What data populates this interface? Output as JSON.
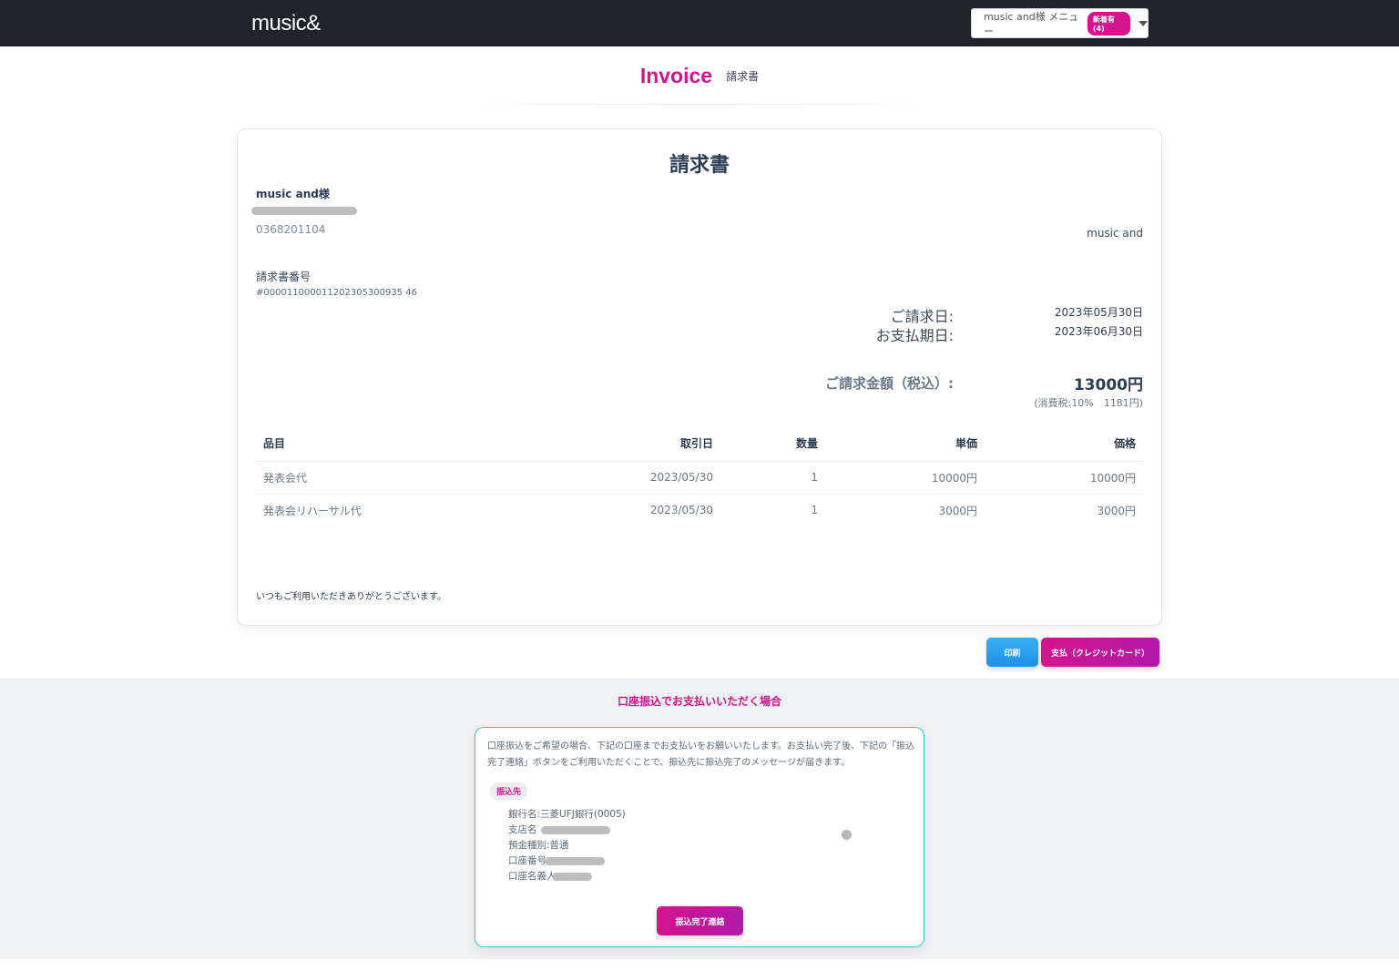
{
  "header": {
    "brand": "music&",
    "menu_label": "music and様 メニュー",
    "menu_badge": "新着有(4)"
  },
  "page": {
    "title_en": "Invoice",
    "title_jp": "請求書"
  },
  "invoice": {
    "doc_title": "請求書",
    "customer_name": "music and様",
    "customer_phone": "0368201104",
    "issuer": "music and",
    "invoice_no_label": "請求書番号",
    "invoice_no": "#000011000011202305300935 46",
    "billing_date_label": "ご請求日:",
    "billing_date": "2023年05月30日",
    "due_date_label": "お支払期日:",
    "due_date": "2023年06月30日",
    "total_label": "ご請求金額（税込）:",
    "total_value": "13000円",
    "tax_note": "(消費税:10%　1181円)",
    "columns": [
      "品目",
      "取引日",
      "数量",
      "単価",
      "価格"
    ],
    "items": [
      {
        "name": "発表会代",
        "date": "2023/05/30",
        "qty": "1",
        "unit": "10000円",
        "price": "10000円"
      },
      {
        "name": "発表会リハーサル代",
        "date": "2023/05/30",
        "qty": "1",
        "unit": "3000円",
        "price": "3000円"
      }
    ],
    "thanks": "いつもご利用いただきありがとうございます。"
  },
  "actions": {
    "print": "印刷",
    "pay_credit": "支払（クレジットカード）"
  },
  "bank": {
    "section_title": "口座振込でお支払いいただく場合",
    "description": "口座振込をご希望の場合、下記の口座までお支払いをお願いいたします。お支払い完了後、下記の「振込完了連絡」ボタンをご利用いただくことで、振込先に振込完了のメッセージが届きます。",
    "badge": "振込先",
    "bank_name": "銀行名:三菱UFJ銀行(0005)",
    "branch_label": "支店名",
    "account_type": "預金種別:普通",
    "account_no_label": "口座番号",
    "account_holder_label": "口座名義人",
    "done_button": "振込完了連絡"
  },
  "colors": {
    "accent": "#d4148c",
    "topbar": "#202328",
    "print_button": "#1f8fe8",
    "bank_border": "#35c0e0"
  }
}
